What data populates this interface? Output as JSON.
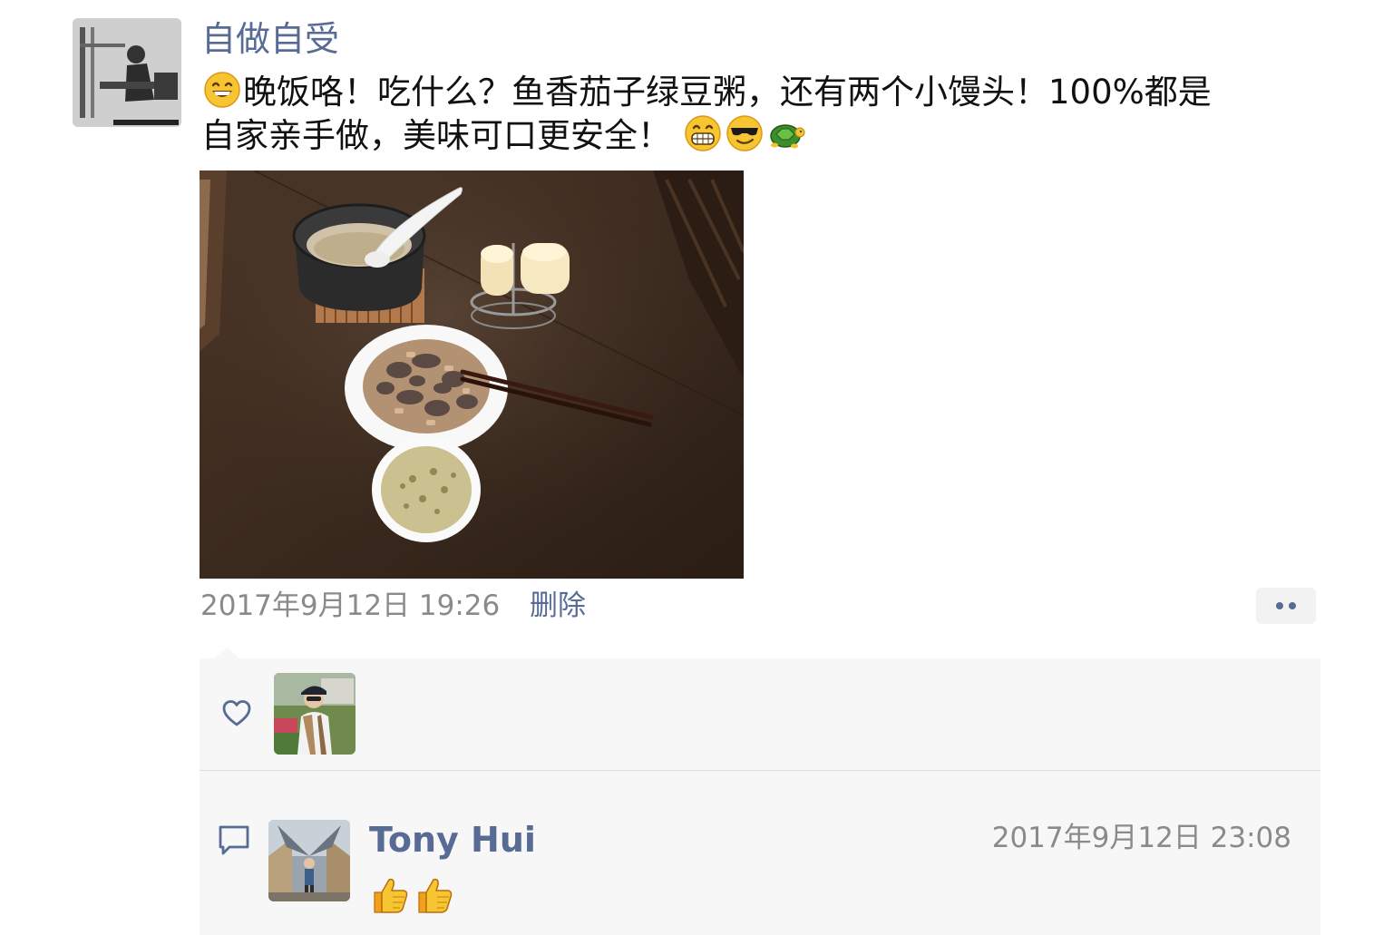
{
  "post": {
    "author": "自做自受",
    "text_line1_main": "晚饭咯！吃什么？鱼香茄子绿豆粥，还有两个小馒头！100%都是",
    "text_line2_main": "自家亲手做，美味可口更安全！",
    "leading_emoji": "smile-emoji",
    "trailing_emojis": [
      "grin-emoji",
      "cool-emoji",
      "turtle-emoji"
    ],
    "photo": "dinner-photo",
    "time": "2017年9月12日 19:26",
    "delete_label": "删除",
    "more_icon": "more-dots-icon"
  },
  "likes": {
    "icon": "heart-icon",
    "likers": [
      "liker-avatar"
    ]
  },
  "comments": [
    {
      "icon": "comment-icon",
      "name": "Tony Hui",
      "time": "2017年9月12日 23:08",
      "emojis": [
        "thumbs-up-emoji",
        "thumbs-up-emoji"
      ]
    }
  ],
  "colors": {
    "link": "#576b95",
    "muted": "#8a8a8a",
    "panel": "#f7f7f7"
  }
}
